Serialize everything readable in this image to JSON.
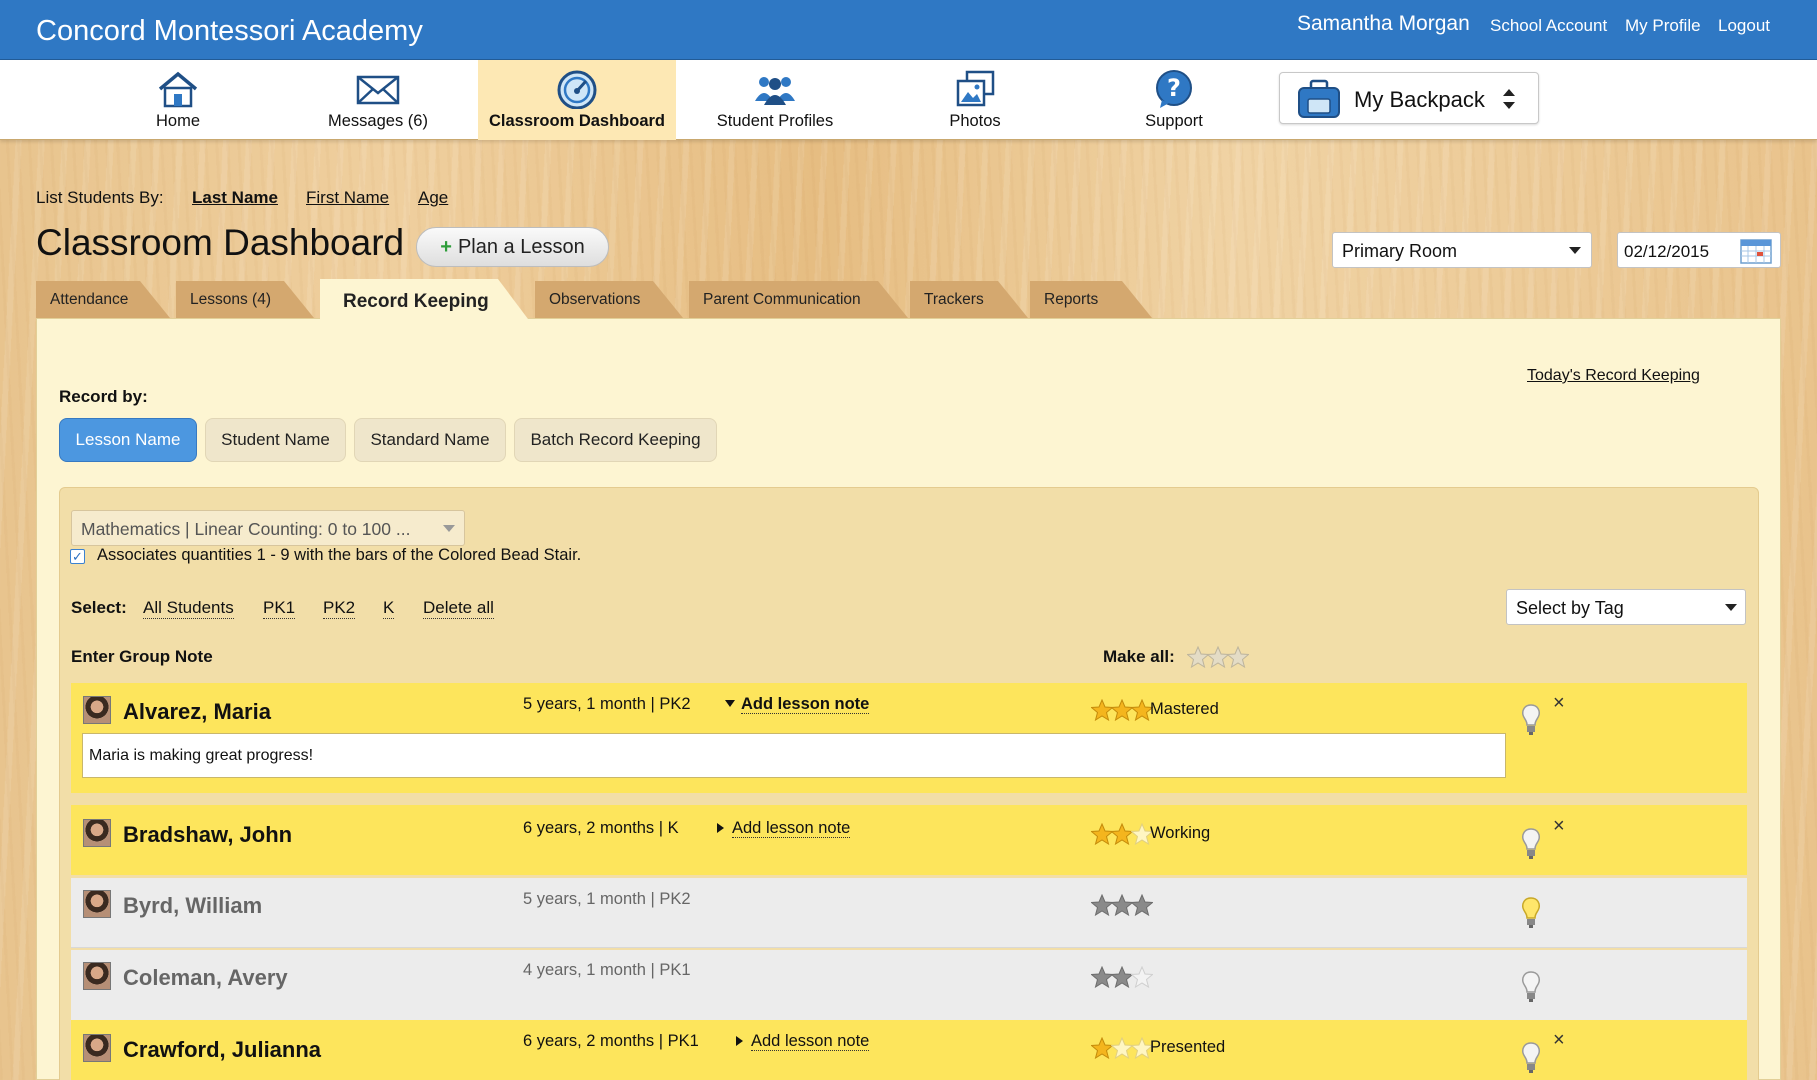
{
  "header": {
    "app_title": "Concord Montessori Academy",
    "user_name": "Samantha Morgan",
    "links": [
      "School Account",
      "My Profile",
      "Logout"
    ]
  },
  "nav": {
    "items": [
      {
        "label": "Home",
        "icon": "home-icon"
      },
      {
        "label": "Messages (6)",
        "icon": "envelope-icon"
      },
      {
        "label": "Classroom Dashboard",
        "icon": "dashboard-gauge-icon",
        "active": true
      },
      {
        "label": "Student Profiles",
        "icon": "people-icon"
      },
      {
        "label": "Photos",
        "icon": "photos-icon"
      },
      {
        "label": "Support",
        "icon": "help-icon"
      }
    ],
    "backpack_label": "My Backpack"
  },
  "list_by": {
    "label": "List Students By:",
    "options": [
      "Last Name",
      "First Name",
      "Age"
    ],
    "active": "Last Name"
  },
  "page": {
    "title": "Classroom Dashboard",
    "plan_button": "Plan a Lesson",
    "room": "Primary Room",
    "date": "02/12/2015"
  },
  "tabs": [
    "Attendance",
    "Lessons (4)",
    "Record Keeping",
    "Observations",
    "Parent Communication",
    "Trackers",
    "Reports"
  ],
  "active_tab": "Record Keeping",
  "record": {
    "today_link": "Today's Record Keeping",
    "record_by_label": "Record by:",
    "record_by_options": [
      "Lesson Name",
      "Student Name",
      "Standard Name",
      "Batch Record Keeping"
    ],
    "lesson_select": "Mathematics | Linear Counting: 0 to 100 ...",
    "checkbox_checked": true,
    "checkbox_label": "Associates quantities 1 - 9 with the bars of the Colored Bead Stair.",
    "select_label": "Select:",
    "select_options": [
      "All Students",
      "PK1",
      "PK2",
      "K",
      "Delete all"
    ],
    "tag_select": "Select by Tag",
    "group_note": "Enter Group Note",
    "make_all": "Make all:"
  },
  "students": [
    {
      "name": "Alvarez, Maria",
      "age": "5 years, 1 month | PK2",
      "note_link": "Add lesson note",
      "stars": 3,
      "status": "Mastered",
      "highlight": true,
      "expanded": true,
      "note": "Maria is making great progress!"
    },
    {
      "name": "Bradshaw, John",
      "age": "6 years, 2 months | K",
      "note_link": "Add lesson note",
      "stars": 2,
      "status": "Working",
      "highlight": true,
      "expanded": false
    },
    {
      "name": "Byrd, William",
      "age": "5 years, 1 month | PK2",
      "stars": 3,
      "highlight": false
    },
    {
      "name": "Coleman, Avery",
      "age": "4 years, 1 month | PK1",
      "stars": 2,
      "highlight": false
    },
    {
      "name": "Crawford, Julianna",
      "age": "6 years, 2 months | PK1",
      "note_link": "Add lesson note",
      "stars": 1,
      "status": "Presented",
      "highlight": true,
      "expanded": false
    }
  ],
  "colors": {
    "brand_blue": "#2f78c4",
    "active_tab": "#fdf5d2",
    "tab": "#d4a86f",
    "highlight_row": "#fde55c",
    "star_gold": "#f4b51d",
    "star_gray": "#8a8a8a"
  }
}
